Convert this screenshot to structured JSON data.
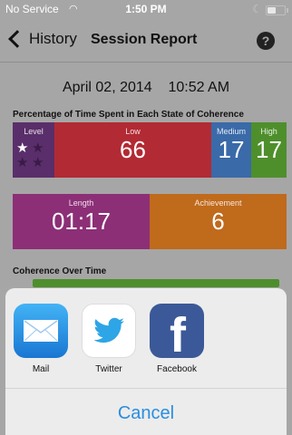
{
  "status": {
    "carrier": "No Service",
    "time": "1:50 PM"
  },
  "nav": {
    "back_label": "History",
    "title": "Session Report",
    "help": "?"
  },
  "session": {
    "date": "April 02, 2014",
    "time": "10:52 AM"
  },
  "coherence": {
    "section_title": "Percentage of Time Spent in Each State of Coherence",
    "level_label": "Level",
    "low_label": "Low",
    "low_value": "66",
    "medium_label": "Medium",
    "medium_value": "17",
    "high_label": "High",
    "high_value": "17",
    "stars_total": 4,
    "stars_filled": 1
  },
  "stats": {
    "length_label": "Length",
    "length_value": "01:17",
    "achievement_label": "Achievement",
    "achievement_value": "6"
  },
  "chart": {
    "section_title": "Coherence Over Time"
  },
  "share": {
    "apps": [
      {
        "label": "Mail",
        "icon": "mail-icon"
      },
      {
        "label": "Twitter",
        "icon": "twitter-icon"
      },
      {
        "label": "Facebook",
        "icon": "facebook-icon"
      }
    ],
    "cancel_label": "Cancel"
  },
  "colors": {
    "low": "#b22a33",
    "medium": "#3a6aa8",
    "high": "#4e8f2c",
    "level": "#5a2e6a",
    "length": "#8c2f77",
    "achievement": "#c06a1c",
    "accent": "#2a8ee0"
  }
}
